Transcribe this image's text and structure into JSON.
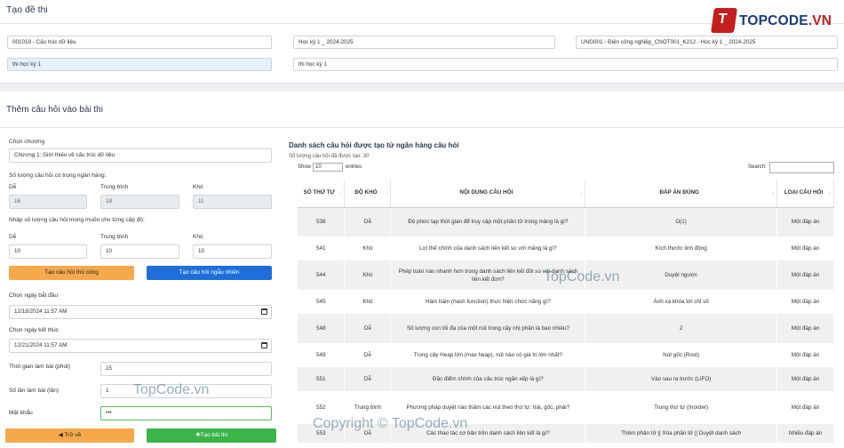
{
  "top": {
    "title": "Tạo đề thi",
    "subject": "001019 - Cấu trúc dữ liệu",
    "semester": "Học kỳ 1 _ 2024-2025",
    "class": "UNG001 - Điện công nghiệp_CNOT001_K212 - Học kỳ 1 _ 2024-2025",
    "exam_type": "thi học kỳ 1",
    "exam_name": "thi học kỳ 1"
  },
  "logo": {
    "mark": "T",
    "text_a": "TOPCODE",
    "text_b": ".VN"
  },
  "section_title": "Thêm câu hỏi vào bài thi",
  "form": {
    "chapter_label": "Chọn chương",
    "chapter_value": "Chương 1: Giới thiệu về cấu trúc dữ liệu",
    "bank_label": "Số lượng câu hỏi có trong ngân hàng:",
    "easy": "Dễ",
    "medium": "Trung bình",
    "hard": "Khó",
    "bank_easy": "16",
    "bank_medium": "18",
    "bank_hard": "11",
    "desired_label": "Nhập số lượng câu hỏi mong muốn cho từng cấp độ:",
    "want_easy": "10",
    "want_medium": "10",
    "want_hard": "10",
    "manual_btn": "Tạo câu hỏi thủ công",
    "random_btn": "Tạo câu hỏi ngẫu nhiên",
    "start_label": "Chọn ngày bắt đầu",
    "start_value": "12/18/2024 11:57 AM",
    "end_label": "Chọn ngày kết thúc",
    "end_value": "12/21/2024 11:57 AM",
    "duration_label": "Thời gian làm bài (phút)",
    "duration_value": "15",
    "attempts_label": "Số lần làm bài (lần)",
    "attempts_value": "1",
    "password_label": "Mật khẩu",
    "password_value": "•••",
    "back_btn": "Trở về",
    "create_btn": "Tạo bài thi"
  },
  "list": {
    "title": "Danh sách câu hỏi được tạo từ ngân hàng câu hỏi",
    "count": "Số lượng câu hỏi đã được tạo: 30",
    "show": "Show",
    "entries_value": "10",
    "entries": "entries",
    "search": "Search:",
    "headers": [
      "SỐ THỨ TỰ",
      "ĐỘ KHÓ",
      "NỘI DUNG CÂU HỎI",
      "ĐÁP ÁN ĐÚNG",
      "LOẠI CÂU HỎI"
    ],
    "rows": [
      [
        "538",
        "Dễ",
        "Độ phức tạp thời gian để truy cập một phần tử trong mảng là gì?",
        "O(1)",
        "Một đáp án"
      ],
      [
        "541",
        "Khó",
        "Lợi thế chính của danh sách liên kết so với mảng là gì?",
        "Kích thước linh động",
        "Một đáp án"
      ],
      [
        "544",
        "Khó",
        "Phép toán nào nhanh hơn trong danh sách liên kết đôi so với danh sách liên kết đơn?",
        "Duyệt ngược",
        "Một đáp án"
      ],
      [
        "545",
        "Khó",
        "Hàm băm (hash function) thực hiện chức năng gì?",
        "Ánh xạ khóa tới chỉ số",
        "Một đáp án"
      ],
      [
        "548",
        "Dễ",
        "Số lượng con tối đa của một nút trong cây nhị phân là bao nhiêu?",
        "2",
        "Một đáp án"
      ],
      [
        "549",
        "Dễ",
        "Trong cây Heap lớn (max heap), nút nào có giá trị lớn nhất?",
        "Nút gốc (Root)",
        "Một đáp án"
      ],
      [
        "551",
        "Dễ",
        "Đặc điểm chính của cấu trúc ngăn xếp là gì?",
        "Vào sau ra trước (LIFO)",
        "Một đáp án"
      ],
      [
        "552",
        "Trung bình",
        "Phương pháp duyệt nào thăm các nút theo thứ tự: trái, gốc, phải?",
        "Trung thứ tự (Inorder)",
        "Một đáp án"
      ],
      [
        "553",
        "Dễ",
        "Các thao tác cơ bản trên danh sách liên kết là gì?",
        "Thêm phần tử || Xóa phần tử || Duyệt danh sách",
        "Nhiều đáp án"
      ]
    ]
  },
  "watermarks": [
    "TopCode.vn",
    "TopCode.vn",
    "Copyright © TopCode.vn"
  ]
}
